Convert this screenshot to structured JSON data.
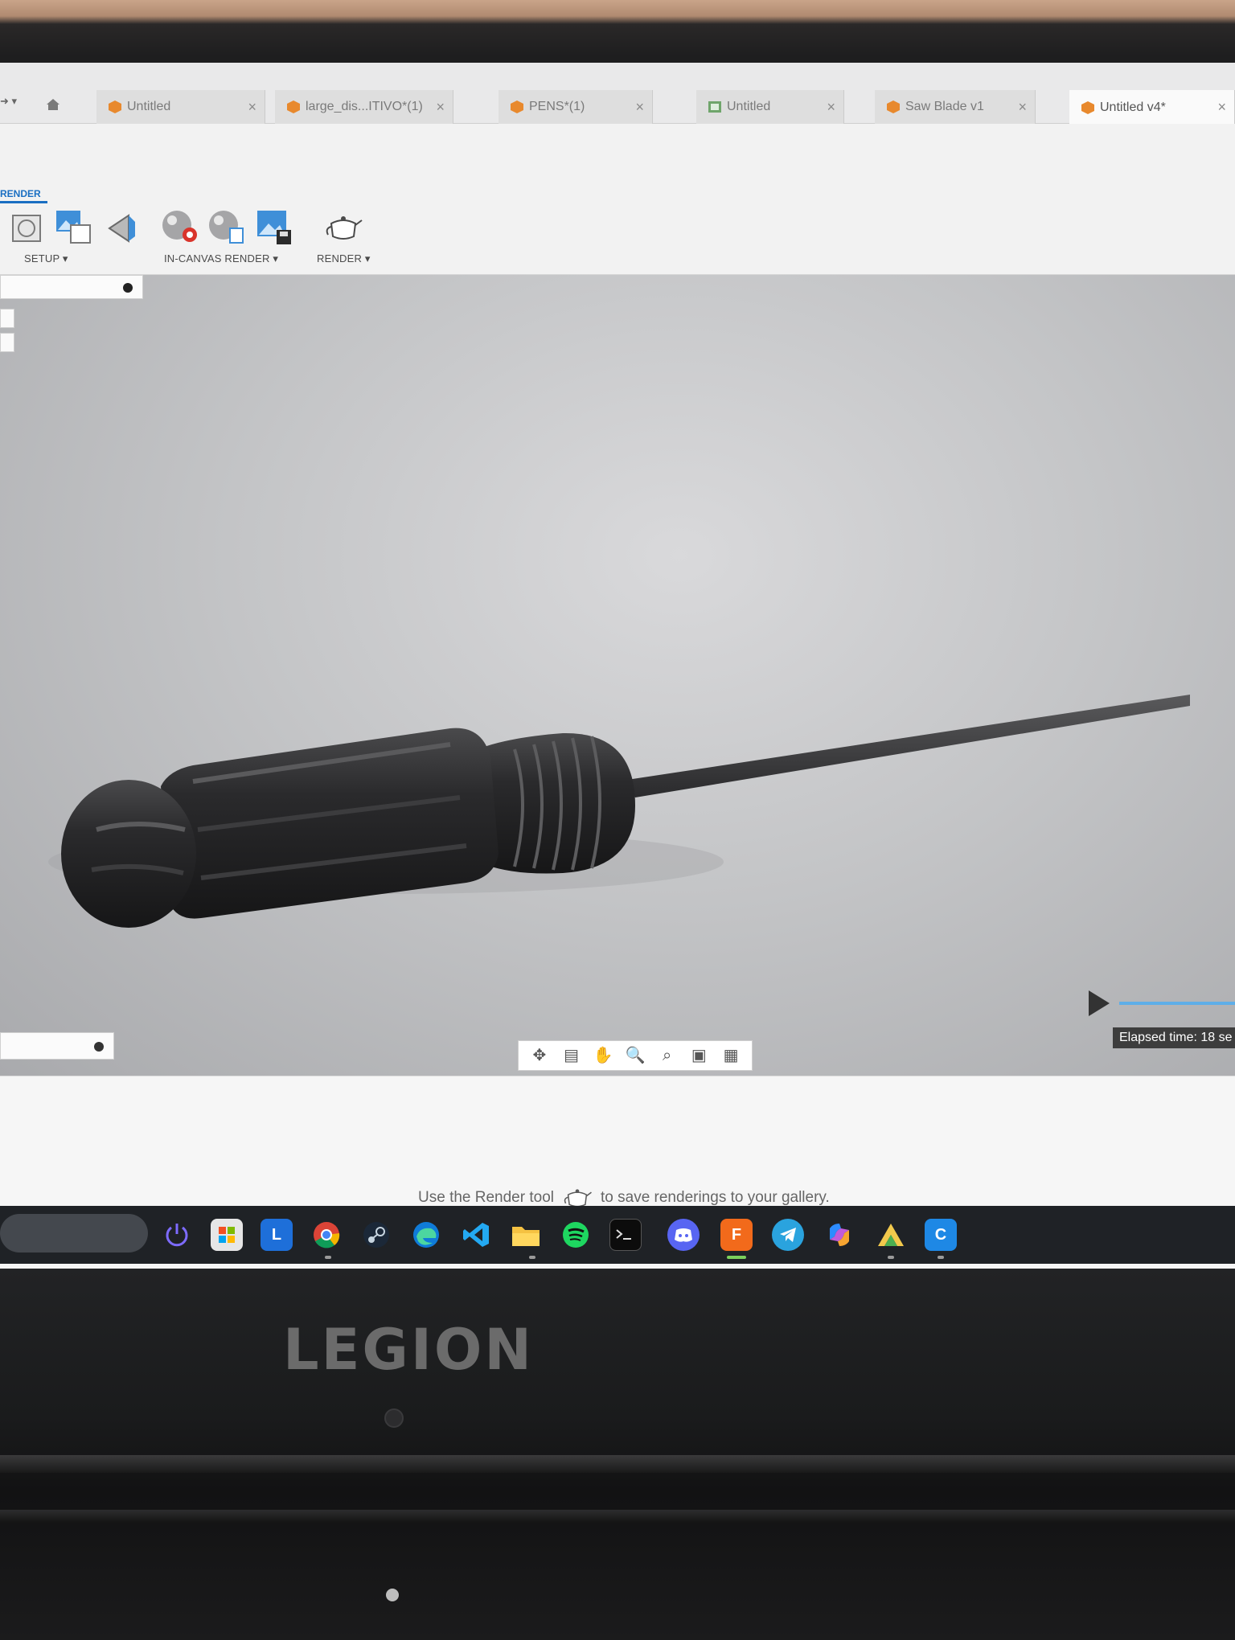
{
  "app": {
    "workspace_label": "RENDER"
  },
  "tabs": [
    {
      "label": "Untitled",
      "active": false
    },
    {
      "label": "large_dis...ITIVO*(1)",
      "active": false
    },
    {
      "label": "PENS*(1)",
      "active": false
    },
    {
      "label": "Untitled",
      "active": false
    },
    {
      "label": "Saw Blade v1",
      "active": false
    },
    {
      "label": "Untitled v4*",
      "active": true
    }
  ],
  "toolbar": {
    "groups": [
      {
        "label": "SETUP ▾"
      },
      {
        "label": "IN-CANVAS RENDER ▾"
      },
      {
        "label": "RENDER ▾"
      }
    ]
  },
  "viewport": {
    "model_subject": "screwdriver-model",
    "elapsed_label": "Elapsed time: 18 se"
  },
  "gallery": {
    "hint_before": "Use the Render tool",
    "hint_after": "to save renderings to your gallery."
  },
  "taskbar": {
    "apps": [
      "power-icon",
      "store-icon",
      "L-app-icon",
      "chrome-icon",
      "steam-icon",
      "edge-icon",
      "vscode-icon",
      "files-icon",
      "spotify-icon",
      "terminal-icon",
      "discord-icon",
      "fusion360-icon",
      "telegram-icon",
      "copilot-icon",
      "autodesk-icon",
      "c-app-icon"
    ],
    "L_label": "L",
    "F_label": "F",
    "C_label": "C"
  },
  "device": {
    "brand": "LEGION"
  },
  "colors": {
    "accent_blue": "#1a6fc2",
    "doc_orange": "#e8892d",
    "progress_blue": "#5eaee8"
  }
}
